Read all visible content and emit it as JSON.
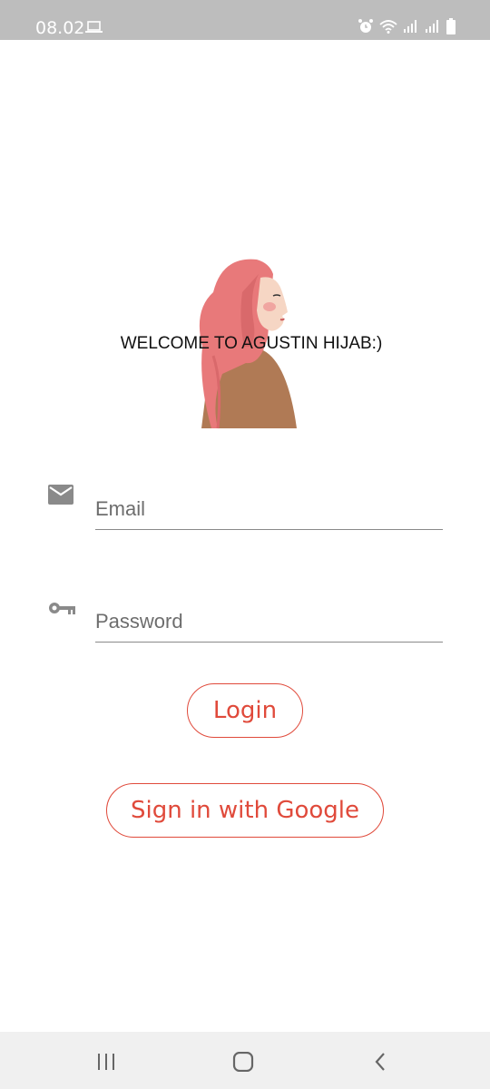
{
  "status_bar": {
    "time": "08.02",
    "icons": [
      "laptop-icon",
      "alarm-icon",
      "wifi-icon",
      "signal-icon",
      "signal-icon",
      "battery-icon"
    ]
  },
  "hero": {
    "welcome_text": "WELCOME TO AGUSTIN HIJAB:)",
    "illustration": "hijab-woman-illustration"
  },
  "form": {
    "email": {
      "placeholder": "Email",
      "value": "",
      "icon": "mail-icon"
    },
    "password": {
      "placeholder": "Password",
      "value": "",
      "icon": "key-icon"
    }
  },
  "buttons": {
    "login_label": "Login",
    "google_label": "Sign in with Google"
  },
  "nav_bar": {
    "items": [
      "recents-icon",
      "home-icon",
      "back-icon"
    ]
  },
  "colors": {
    "accent": "#e04a3b",
    "status_bar_bg": "#bdbdbd",
    "nav_bar_bg": "#f0f0f0",
    "hijab": "#e8797a",
    "clothing": "#b07a55"
  }
}
